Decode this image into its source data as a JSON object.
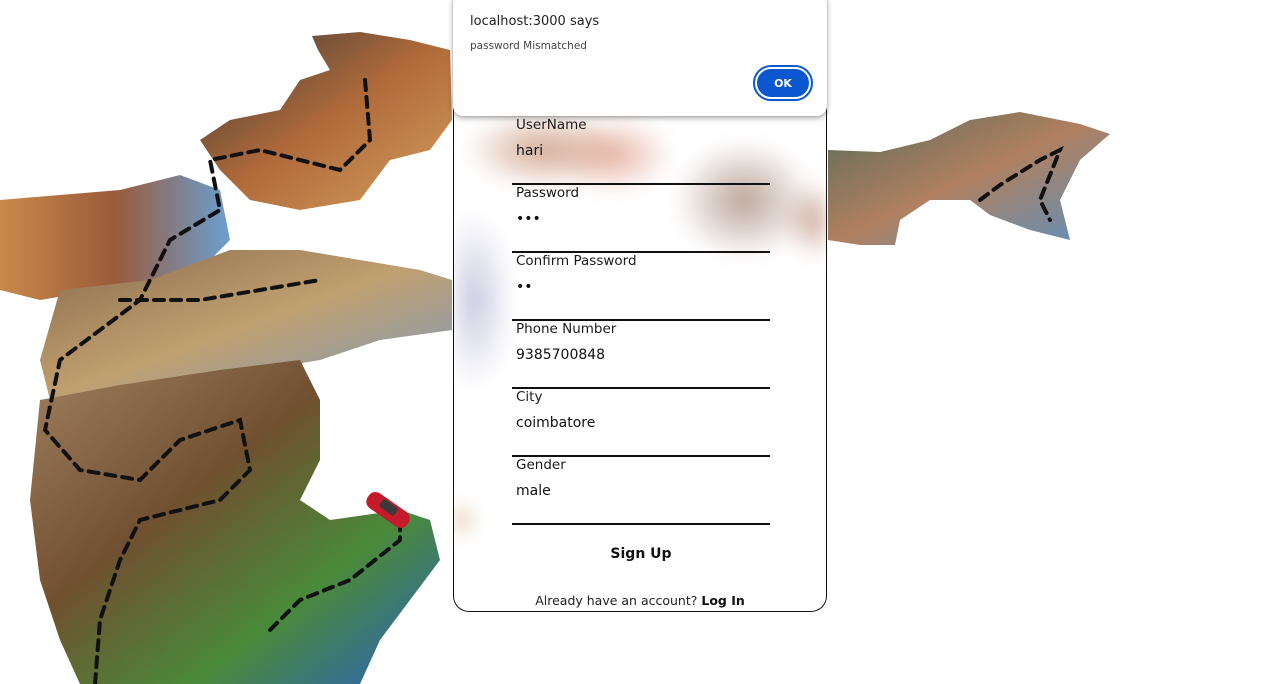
{
  "dialog": {
    "title": "localhost:3000 says",
    "message": "password Mismatched",
    "ok_label": "OK"
  },
  "form": {
    "fields": [
      {
        "label": "UserName",
        "value": "hari"
      },
      {
        "label": "Password",
        "value": "•••"
      },
      {
        "label": "Confirm Password",
        "value": "••"
      },
      {
        "label": "Phone Number",
        "value": "9385700848"
      },
      {
        "label": "City",
        "value": "coimbatore"
      },
      {
        "label": "Gender",
        "value": "male"
      }
    ],
    "submit_label": "Sign Up",
    "login_prompt": "Already have an account?",
    "login_link": "Log In"
  },
  "colors": {
    "dialog_button": "#0b57d0",
    "field_underline": "#111111"
  }
}
